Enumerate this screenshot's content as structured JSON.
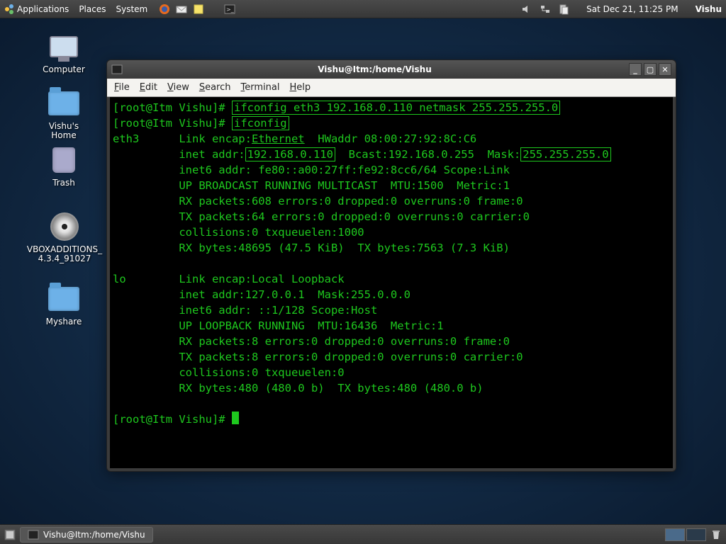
{
  "top_panel": {
    "menus": [
      "Applications",
      "Places",
      "System"
    ],
    "clock": "Sat Dec 21, 11:25 PM",
    "user": "Vishu"
  },
  "desktop": {
    "computer": "Computer",
    "home": "Vishu's Home",
    "trash": "Trash",
    "vbox": "VBOXADDITIONS_4.3.4_91027",
    "myshare": "Myshare"
  },
  "window": {
    "title": "Vishu@Itm:/home/Vishu",
    "menus": [
      "File",
      "Edit",
      "View",
      "Search",
      "Terminal",
      "Help"
    ]
  },
  "term": {
    "prompt": "[root@Itm Vishu]#",
    "cmd1": "ifconfig eth3 192.168.0.110 netmask 255.255.255.0",
    "cmd2": "ifconfig",
    "eth3_line1a": "eth3      Link encap:",
    "eth3_underlined": "Ethernet",
    "eth3_line1b": "  HWaddr 08:00:27:92:8C:C6",
    "eth3_inet_a": "          inet addr:",
    "eth3_ip": "192.168.0.110",
    "eth3_inet_b": "  Bcast:192.168.0.255  Mask:",
    "eth3_mask": "255.255.255.0",
    "eth3_inet6": "          inet6 addr: fe80::a00:27ff:fe92:8cc6/64 Scope:Link",
    "eth3_up": "          UP BROADCAST RUNNING MULTICAST  MTU:1500  Metric:1",
    "eth3_rxp": "          RX packets:608 errors:0 dropped:0 overruns:0 frame:0",
    "eth3_txp": "          TX packets:64 errors:0 dropped:0 overruns:0 carrier:0",
    "eth3_col": "          collisions:0 txqueuelen:1000",
    "eth3_bytes": "          RX bytes:48695 (47.5 KiB)  TX bytes:7563 (7.3 KiB)",
    "lo_line1": "lo        Link encap:Local Loopback",
    "lo_inet": "          inet addr:127.0.0.1  Mask:255.0.0.0",
    "lo_inet6": "          inet6 addr: ::1/128 Scope:Host",
    "lo_up": "          UP LOOPBACK RUNNING  MTU:16436  Metric:1",
    "lo_rxp": "          RX packets:8 errors:0 dropped:0 overruns:0 frame:0",
    "lo_txp": "          TX packets:8 errors:0 dropped:0 overruns:0 carrier:0",
    "lo_col": "          collisions:0 txqueuelen:0",
    "lo_bytes": "          RX bytes:480 (480.0 b)  TX bytes:480 (480.0 b)"
  },
  "taskbar": {
    "task1": "Vishu@Itm:/home/Vishu"
  }
}
